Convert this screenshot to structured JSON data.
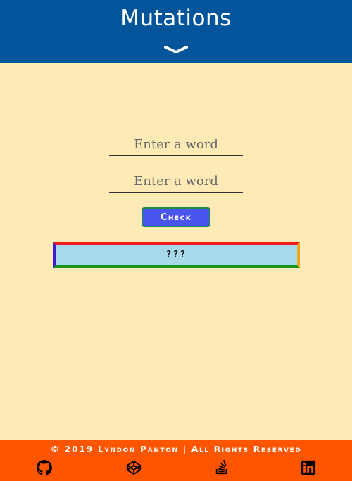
{
  "header": {
    "title": "Mutations",
    "toggle_icon": "chevron-down-icon"
  },
  "form": {
    "input_1": {
      "value": "",
      "placeholder": "Enter a word"
    },
    "input_2": {
      "value": "",
      "placeholder": "Enter a word"
    },
    "check_label": "Check"
  },
  "result": {
    "text": "???"
  },
  "footer": {
    "copyright": "© 2019 Lyndon Panton | All Rights Reserved",
    "links": [
      {
        "icon": "github-icon"
      },
      {
        "icon": "codepen-icon"
      },
      {
        "icon": "stackoverflow-icon"
      },
      {
        "icon": "linkedin-icon"
      }
    ]
  },
  "colors": {
    "header_bg": "#02559b",
    "page_bg": "#fdeab4",
    "button_bg": "#4a55f0",
    "button_border": "#1e8a4c",
    "result_bg": "#a8d9ea",
    "result_border_top": "#ee1c1c",
    "result_border_bottom": "#17941c",
    "result_border_left": "#3e1ad1",
    "result_border_right": "#f0a81c",
    "footer_bg": "#fe5500"
  }
}
